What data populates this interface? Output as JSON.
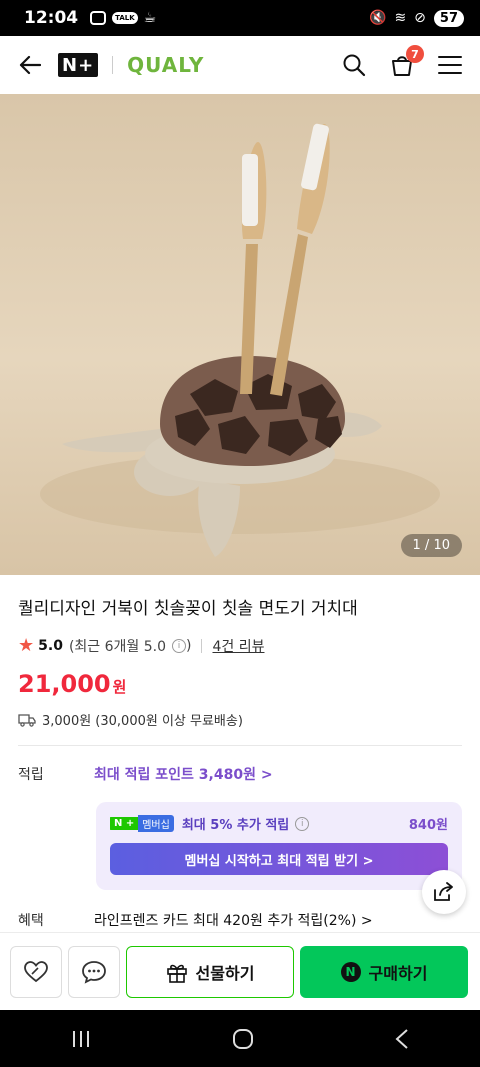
{
  "status_bar": {
    "time": "12:04",
    "talk": "TALK",
    "battery": "57"
  },
  "app_bar": {
    "n_plus": "N+",
    "brand": "QUALY",
    "cart_count": "7"
  },
  "gallery": {
    "counter": "1 / 10"
  },
  "product": {
    "title": "퀄리디자인 거북이 칫솔꽂이 칫솔 면도기 거치대",
    "rating": "5.0",
    "rating_detail": "(최근 6개월 5.0",
    "rating_detail_end": ")",
    "review_link": "4건 리뷰",
    "price": "21,000",
    "currency": "원",
    "shipping": "3,000원 (30,000원 이상 무료배송)"
  },
  "points": {
    "label": "적립",
    "link": "최대 적립 포인트 3,480원 >",
    "membership_badge_np": "N +",
    "membership_badge_text": "멤버십",
    "membership_text": "최대 5% 추가 적립",
    "membership_amount": "840원",
    "membership_cta": "멤버십 시작하고 최대 적립 받기 >"
  },
  "benefit": {
    "label": "혜택",
    "text": "라인프렌즈 카드 최대 420원 추가 적립(2%) >"
  },
  "actions": {
    "gift_label": "선물하기",
    "buy_label": "구매하기"
  },
  "colors": {
    "price": "#f0283c",
    "brand": "#6fb53d",
    "buy": "#03c75a",
    "accent": "#7b4ecb"
  }
}
